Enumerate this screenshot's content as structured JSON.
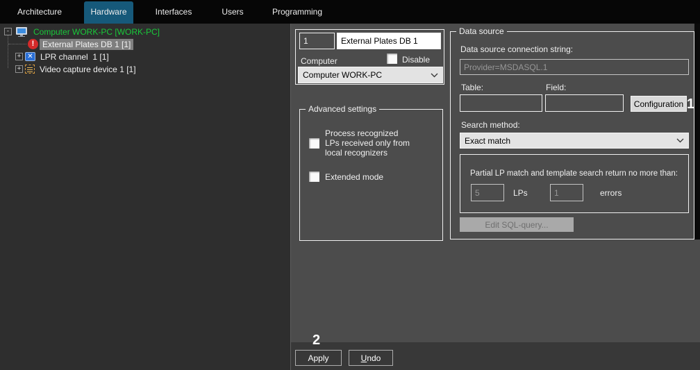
{
  "tabs": {
    "items": [
      {
        "label": "Architecture",
        "active": false
      },
      {
        "label": "Hardware",
        "active": true
      },
      {
        "label": "Interfaces",
        "active": false
      },
      {
        "label": "Users",
        "active": false
      },
      {
        "label": "Programming",
        "active": false
      }
    ]
  },
  "tree": {
    "items": [
      {
        "label": "Computer WORK-PC [WORK-PC]",
        "icon": "computer-icon",
        "expander": "-",
        "selected": false
      },
      {
        "label": "External Plates DB 1 [1]",
        "icon": "error-icon",
        "expander": "",
        "selected": true
      },
      {
        "label": "LPR channel  1 [1]",
        "icon": "lpr-channel-icon",
        "expander": "+",
        "selected": false
      },
      {
        "label": "Video capture device 1 [1]",
        "icon": "video-capture-icon",
        "expander": "+",
        "selected": false
      }
    ]
  },
  "identity": {
    "id_value": "1",
    "name_value": "External Plates DB 1",
    "computer_label": "Computer",
    "disable_label": "Disable",
    "computer_value": "Computer WORK-PC"
  },
  "advanced": {
    "title": "Advanced settings",
    "checkbox1_label": "Process recognized LPs received only from local recognizers",
    "checkbox2_label": "Extended mode"
  },
  "datasource": {
    "title": "Data source",
    "connection_label": "Data source connection string:",
    "connection_value": "Provider=MSDASQL.1",
    "table_label": "Table:",
    "field_label": "Field:",
    "table_value": "",
    "field_value": "",
    "configuration_button": "Configuration",
    "search_label": "Search method:",
    "search_value": "Exact match",
    "partial_label": "Partial LP match and template search return no more than:",
    "lps_value": "5",
    "lps_label": "LPs",
    "errors_value": "1",
    "errors_label": "errors",
    "edit_sql_button": "Edit SQL-query..."
  },
  "footer": {
    "apply_label": "Apply",
    "undo_label": "Undo"
  },
  "annotations": {
    "step1": "1",
    "step2": "2"
  },
  "colors": {
    "active_tab": "#16597a",
    "tree_root_green": "#19c93a",
    "error_red": "#d42a2a",
    "selection_gray": "#7f7f7f",
    "panel_dark": "#2e2e2e",
    "panel_mid": "#4c4c4c"
  }
}
